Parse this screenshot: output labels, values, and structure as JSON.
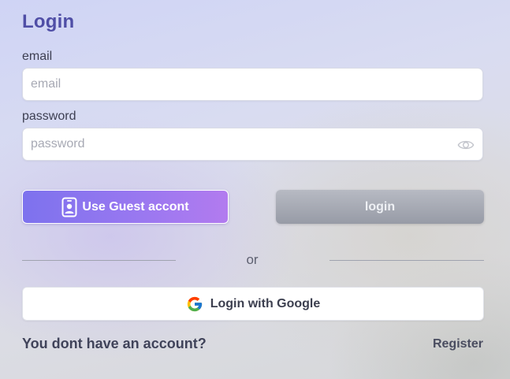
{
  "header": {
    "title": "Login"
  },
  "form": {
    "email_label": "email",
    "email_placeholder": "email",
    "email_value": "",
    "password_label": "password",
    "password_placeholder": "password",
    "password_value": "",
    "password_toggle_icon": "eye-icon"
  },
  "actions": {
    "guest_label": "Use Guest accont",
    "guest_icon": "guest-badge-icon",
    "login_label": "login",
    "divider_text": "or",
    "google_label": "Login with Google",
    "google_icon": "google-logo-icon"
  },
  "footer": {
    "prompt": "You dont have an account?",
    "register_label": "Register"
  },
  "colors": {
    "title": "#4f4ea6",
    "guest_gradient_start": "#7d72ee",
    "guest_gradient_end": "#b27bef",
    "login_disabled": "#a3a7b1"
  }
}
